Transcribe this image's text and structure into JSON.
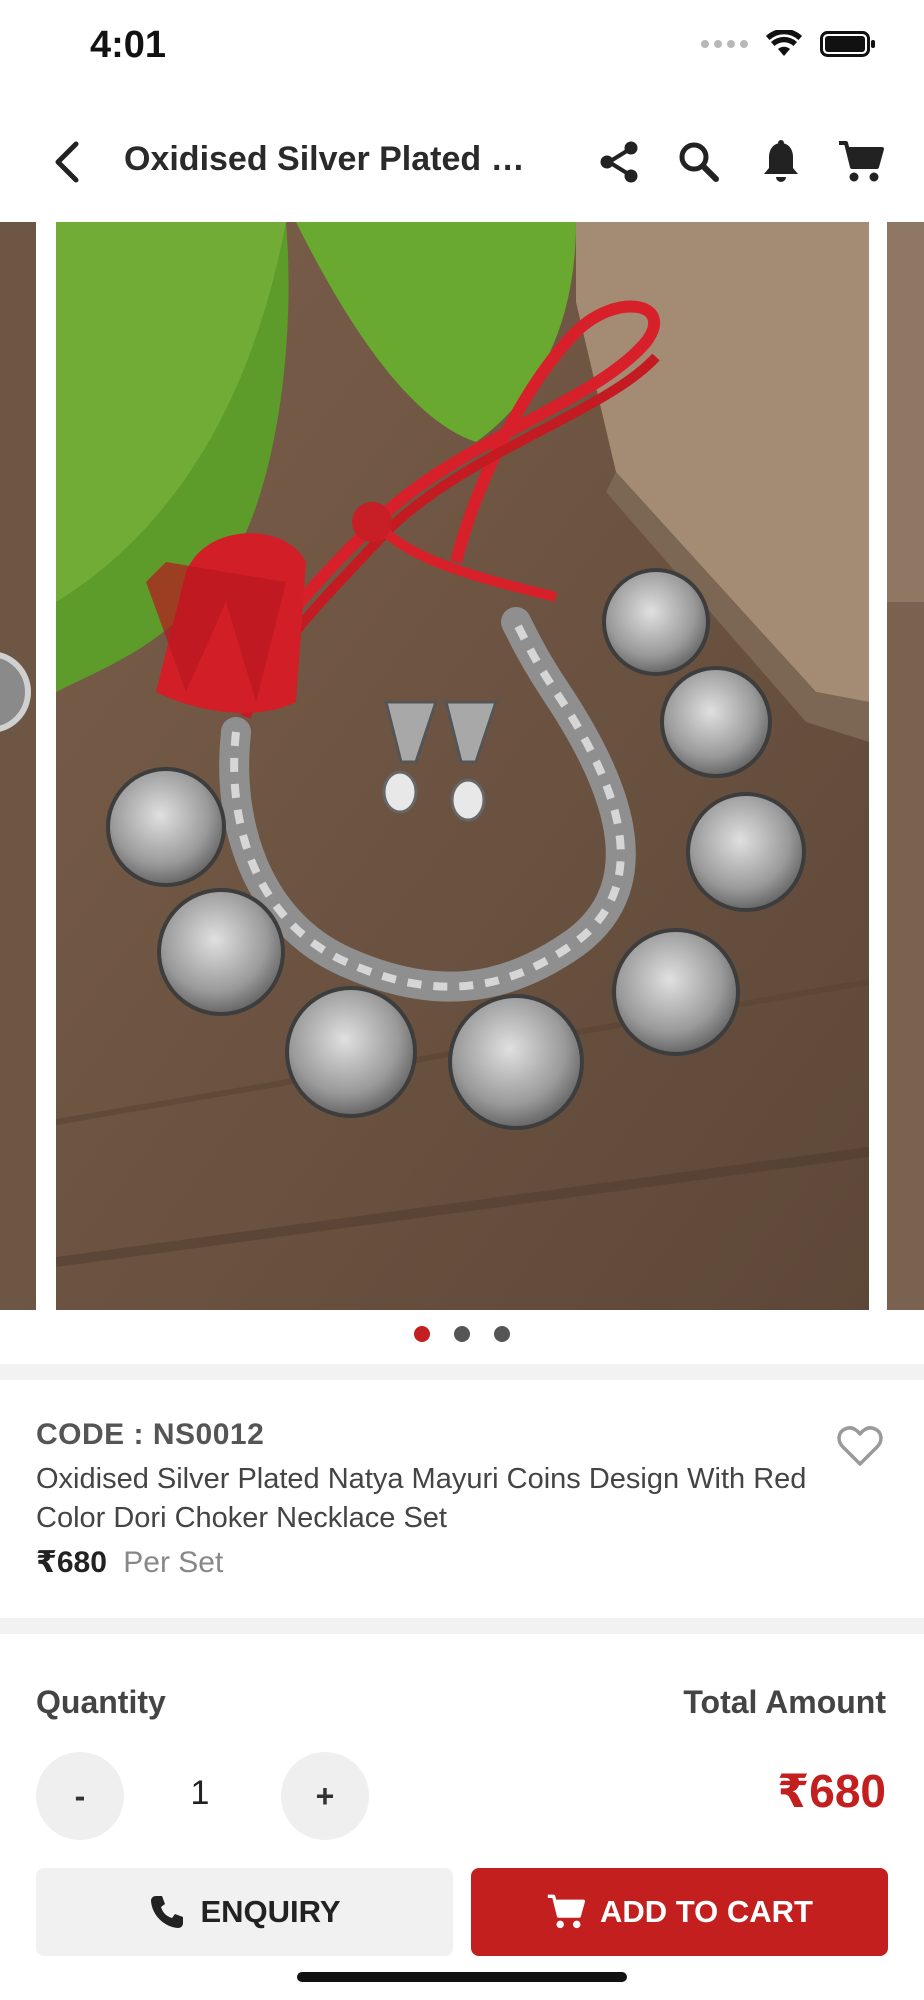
{
  "status_bar": {
    "time": "4:01"
  },
  "header": {
    "title": "Oxidised Silver Plated Natya Mayuri Coins Design With Red Color Dori Choker Necklace Set"
  },
  "icons": {
    "back": "back-arrow-icon",
    "share": "share-icon",
    "search": "search-icon",
    "notifications": "bell-icon",
    "cart": "cart-icon",
    "wishlist": "heart-outline-icon",
    "phone": "phone-icon"
  },
  "carousel": {
    "slide_count": 3,
    "active_index": 0
  },
  "product": {
    "code": "CODE : NS0012",
    "name": "Oxidised Silver Plated Natya Mayuri Coins Design With Red Color Dori Choker Necklace Set",
    "price": "₹680",
    "unit": "Per Set"
  },
  "quantity": {
    "label": "Quantity",
    "value": "1",
    "decrement": "-",
    "increment": "+"
  },
  "total": {
    "label": "Total Amount",
    "value": "₹680"
  },
  "actions": {
    "enquiry": "ENQUIRY",
    "add_to_cart": "ADD TO CART"
  },
  "colors": {
    "accent": "#c41f1f",
    "light_bg": "#f1f1f1"
  }
}
